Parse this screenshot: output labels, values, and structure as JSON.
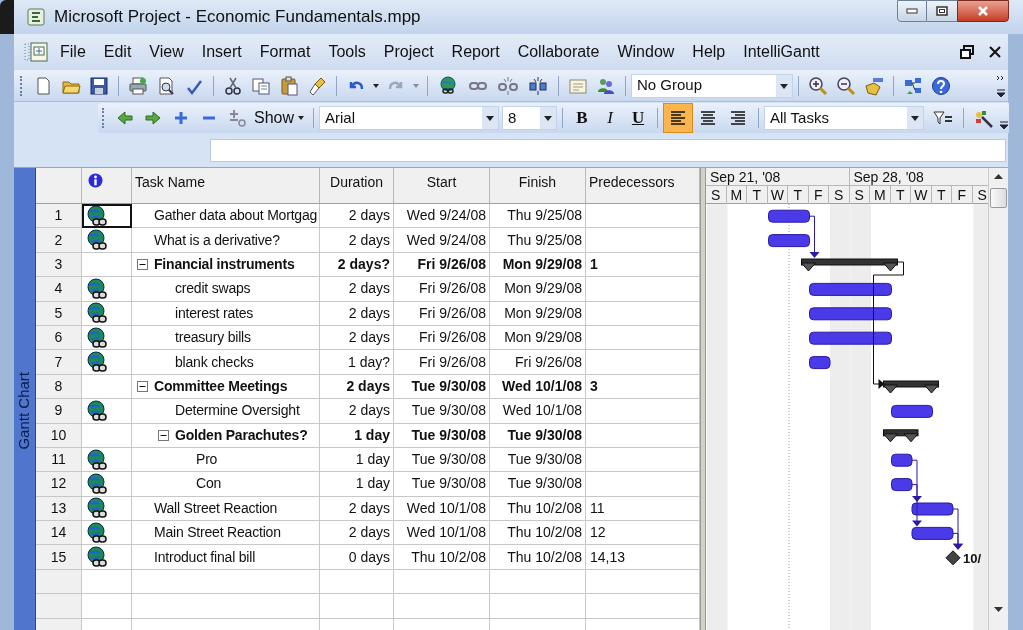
{
  "window": {
    "title": "Microsoft Project - Economic Fundamentals.mpp"
  },
  "menu": [
    {
      "label": "File"
    },
    {
      "label": "Edit"
    },
    {
      "label": "View"
    },
    {
      "label": "Insert"
    },
    {
      "label": "Format"
    },
    {
      "label": "Tools"
    },
    {
      "label": "Project"
    },
    {
      "label": "Report"
    },
    {
      "label": "Collaborate"
    },
    {
      "label": "Window"
    },
    {
      "label": "Help"
    },
    {
      "label": "IntelliGantt"
    }
  ],
  "standard_toolbar": {
    "group_combo": "No Group"
  },
  "formatting_toolbar": {
    "show_button": "Show",
    "font": "Arial",
    "font_size": "8",
    "style_buttons": [
      {
        "label": "B",
        "kind": "bold"
      },
      {
        "label": "I",
        "kind": "italic"
      },
      {
        "label": "U",
        "kind": "underline"
      }
    ],
    "align_buttons": [
      {
        "kind": "left",
        "selected": true
      },
      {
        "kind": "center",
        "selected": false
      },
      {
        "kind": "right",
        "selected": false
      }
    ],
    "filter_combo": "All Tasks"
  },
  "view_bar": {
    "label": "Gantt Chart"
  },
  "table": {
    "columns": [
      {
        "label": "Task Name"
      },
      {
        "label": "Duration"
      },
      {
        "label": "Start"
      },
      {
        "label": "Finish"
      },
      {
        "label": "Predecessors"
      }
    ],
    "rows": [
      {
        "id": "1",
        "kind": "task",
        "indicator": true,
        "selected": true,
        "name": "Gather data about Mortgag",
        "duration": "2 days",
        "start": "Wed 9/24/08",
        "finish": "Thu 9/25/08"
      },
      {
        "id": "2",
        "kind": "task",
        "indicator": true,
        "selected": false,
        "name": "What is a derivative?",
        "duration": "2 days",
        "start": "Wed 9/24/08",
        "finish": "Thu 9/25/08"
      },
      {
        "id": "3",
        "kind": "summary",
        "indicator": false,
        "selected": false,
        "expanded": true,
        "name": "Financial instruments",
        "duration": "2 days?",
        "start": "Fri 9/26/08",
        "finish": "Mon 9/29/08",
        "predecessors": "1",
        "children": [
          {
            "id": "4",
            "kind": "task",
            "indicator": true,
            "selected": false,
            "name": "credit swaps",
            "duration": "2 days",
            "start": "Fri 9/26/08",
            "finish": "Mon 9/29/08"
          },
          {
            "id": "5",
            "kind": "task",
            "indicator": true,
            "selected": false,
            "name": "interest rates",
            "duration": "2 days",
            "start": "Fri 9/26/08",
            "finish": "Mon 9/29/08"
          },
          {
            "id": "6",
            "kind": "task",
            "indicator": true,
            "selected": false,
            "name": "treasury bills",
            "duration": "2 days",
            "start": "Fri 9/26/08",
            "finish": "Mon 9/29/08"
          },
          {
            "id": "7",
            "kind": "task",
            "indicator": true,
            "selected": false,
            "name": "blank checks",
            "duration": "1 day?",
            "start": "Fri 9/26/08",
            "finish": "Fri 9/26/08"
          }
        ]
      },
      {
        "id": "8",
        "kind": "summary",
        "indicator": false,
        "selected": false,
        "expanded": true,
        "name": "Committee Meetings",
        "duration": "2 days",
        "start": "Tue 9/30/08",
        "finish": "Wed 10/1/08",
        "predecessors": "3",
        "children": [
          {
            "id": "9",
            "kind": "task",
            "indicator": true,
            "selected": false,
            "name": "Determine Oversight",
            "duration": "2 days",
            "start": "Tue 9/30/08",
            "finish": "Wed 10/1/08"
          },
          {
            "id": "10",
            "kind": "summary",
            "indicator": false,
            "selected": false,
            "expanded": true,
            "name": "Golden Parachutes?",
            "duration": "1 day",
            "start": "Tue 9/30/08",
            "finish": "Tue 9/30/08",
            "children": [
              {
                "id": "11",
                "kind": "task",
                "indicator": true,
                "selected": false,
                "name": "Pro",
                "duration": "1 day",
                "start": "Tue 9/30/08",
                "finish": "Tue 9/30/08"
              },
              {
                "id": "12",
                "kind": "task",
                "indicator": true,
                "selected": false,
                "name": "Con",
                "duration": "1 day",
                "start": "Tue 9/30/08",
                "finish": "Tue 9/30/08"
              }
            ]
          }
        ]
      },
      {
        "id": "13",
        "kind": "task",
        "indicator": true,
        "selected": false,
        "name": "Wall Street Reaction",
        "duration": "2 days",
        "start": "Wed 10/1/08",
        "finish": "Thu 10/2/08",
        "predecessors": "11"
      },
      {
        "id": "14",
        "kind": "task",
        "indicator": true,
        "selected": false,
        "name": "Main Street Reaction",
        "duration": "2 days",
        "start": "Wed 10/1/08",
        "finish": "Thu 10/2/08",
        "predecessors": "12"
      },
      {
        "id": "15",
        "kind": "milestone",
        "indicator": true,
        "selected": false,
        "name": "Introduct final bill",
        "duration": "0 days",
        "start": "Thu 10/2/08",
        "finish": "Thu 10/2/08",
        "predecessors": "14,13",
        "gantt_label": "10/"
      }
    ]
  },
  "gantt": {
    "weeks": [
      {
        "label": "Sep 21, '08",
        "days": [
          "S",
          "M",
          "T",
          "W",
          "T",
          "F",
          "S"
        ]
      },
      {
        "label": "Sep 28, '08",
        "days": [
          "S",
          "M",
          "T",
          "W",
          "T",
          "F",
          "S"
        ]
      }
    ]
  }
}
